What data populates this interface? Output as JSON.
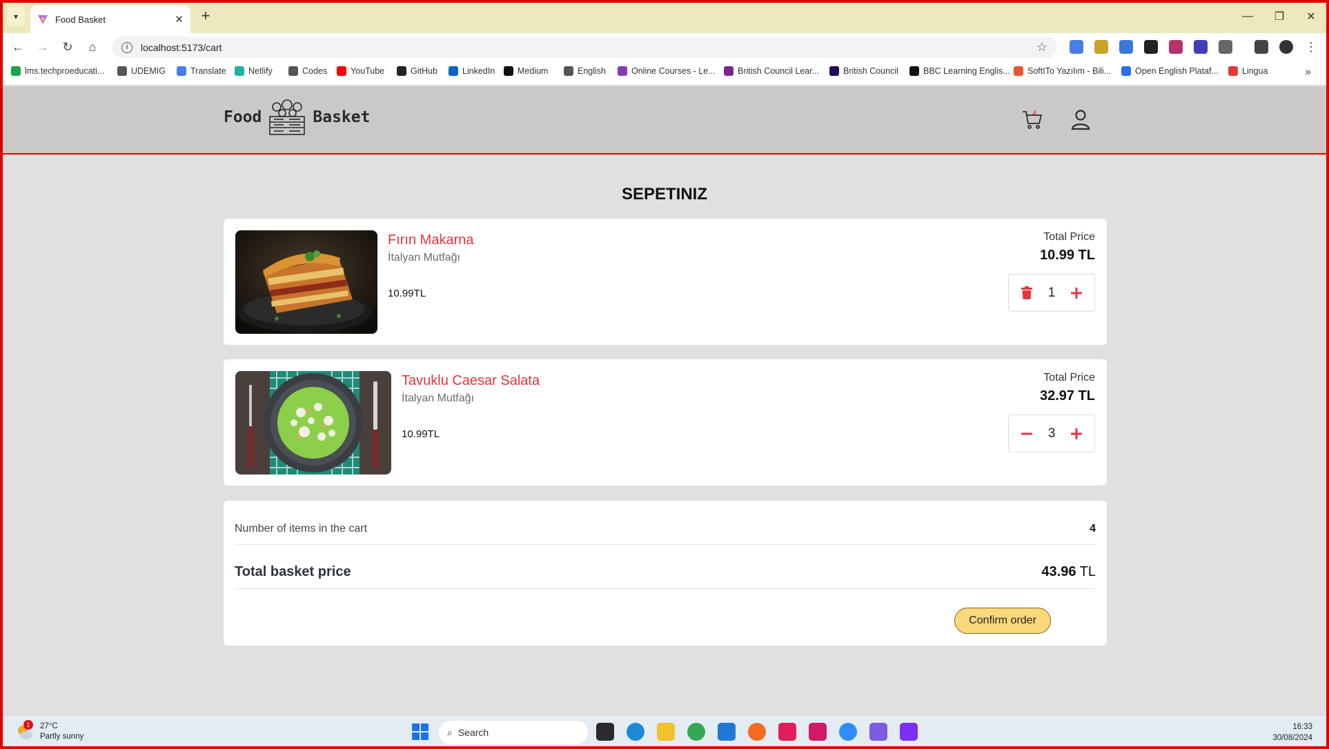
{
  "browser": {
    "tab_title": "Food Basket",
    "url": "localhost:5173/cart",
    "bookmarks": [
      {
        "label": "lms.techproeducati...",
        "icon": "check-circle-icon",
        "color": "#1aa34a"
      },
      {
        "label": "UDEMIG",
        "icon": "folder-icon",
        "color": "#555555"
      },
      {
        "label": "Translate",
        "icon": "translate-icon",
        "color": "#4a7de8"
      },
      {
        "label": "Netlify",
        "icon": "netlify-icon",
        "color": "#20b2aa"
      },
      {
        "label": "Codes",
        "icon": "folder-icon",
        "color": "#555555"
      },
      {
        "label": "YouTube",
        "icon": "youtube-icon",
        "color": "#ff0000"
      },
      {
        "label": "GitHub",
        "icon": "github-icon",
        "color": "#222222"
      },
      {
        "label": "LinkedIn",
        "icon": "linkedin-icon",
        "color": "#0a66c2"
      },
      {
        "label": "Medium",
        "icon": "medium-icon",
        "color": "#111111"
      },
      {
        "label": "English",
        "icon": "folder-icon",
        "color": "#555555"
      },
      {
        "label": "Online Courses - Le...",
        "icon": "course-icon",
        "color": "#8a3ab9"
      },
      {
        "label": "British Council Lear...",
        "icon": "british-council-icon",
        "color": "#7b2a8c"
      },
      {
        "label": "British Council",
        "icon": "british-council-icon",
        "color": "#23085a"
      },
      {
        "label": "BBC Learning Englis...",
        "icon": "bbc-icon",
        "color": "#111111"
      },
      {
        "label": "SoftITo Yazılım - Bili...",
        "icon": "softito-icon",
        "color": "#e8542f"
      },
      {
        "label": "Open English Plataf...",
        "icon": "page-icon",
        "color": "#2a6ee8"
      },
      {
        "label": "Lingua",
        "icon": "lingua-icon",
        "color": "#e53935"
      }
    ]
  },
  "app": {
    "logo_left": "Food",
    "logo_right": "Basket",
    "cart_count": "4",
    "page_title": "SEPETINIZ",
    "items": [
      {
        "name": "Fırın Makarna",
        "cuisine": "İtalyan Mutfağı",
        "price": "10.99TL",
        "total_label": "Total Price",
        "total": "10.99 TL",
        "quantity": "1",
        "decrement_icon": "trash-icon"
      },
      {
        "name": "Tavuklu Caesar Salata",
        "cuisine": "İtalyan Mutfağı",
        "price": "10.99TL",
        "total_label": "Total Price",
        "total": "32.97 TL",
        "quantity": "3",
        "decrement_icon": "minus-icon"
      }
    ],
    "summary": {
      "items_label": "Number of items in the cart",
      "items_value": "4",
      "total_label": "Total basket price",
      "total_value": "43.96",
      "total_currency": "TL",
      "confirm_label": "Confirm order"
    },
    "accent_color": "#e2363c"
  },
  "taskbar": {
    "weather_temp": "27°C",
    "weather_desc": "Partly sunny",
    "weather_badge": "1",
    "search_placeholder": "Search",
    "time": "16:33",
    "date": "30/08/2024"
  }
}
